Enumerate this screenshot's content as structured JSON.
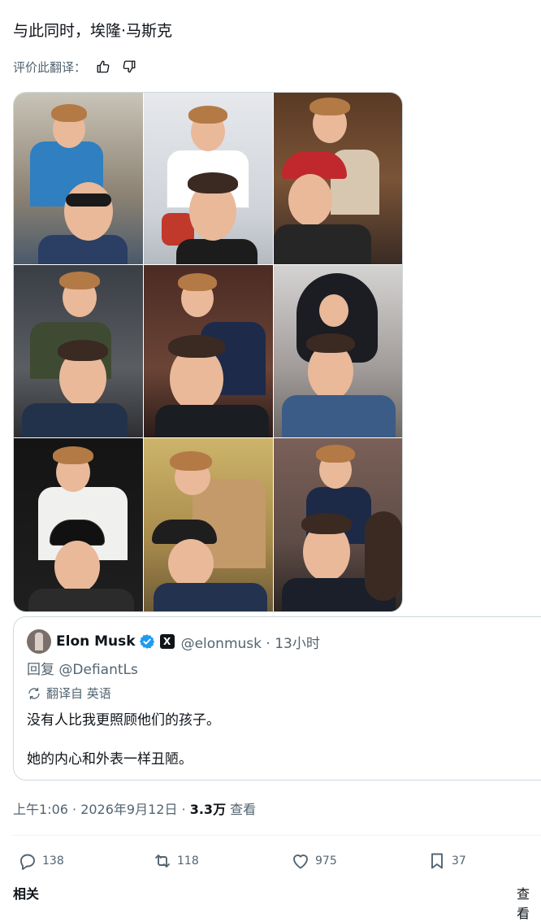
{
  "post": {
    "text": "与此同时，埃隆·马斯克",
    "rate_label": "评价此翻译：",
    "image_alt": "九宫格照片：埃隆·马斯克把孩子扛在肩上"
  },
  "quote": {
    "author_name": "Elon Musk",
    "handle_time": "@elonmusk · 13小时",
    "reply_prefix": "回复",
    "reply_to": "@DefiantLs",
    "translated_from": "翻译自 英语",
    "line1": "没有人比我更照顾他们的孩子。",
    "line2": "她的内心和外表一样丑陋。"
  },
  "meta": {
    "time_date": "上午1:06 · 2026年9月12日 · ",
    "views_count": "3.3万",
    "views_label": " 查看"
  },
  "actions": {
    "replies": "138",
    "reposts": "118",
    "likes": "975",
    "bookmarks": "37"
  },
  "footer": {
    "left": "相关",
    "right": "查看"
  },
  "colors": {
    "text": "#0f1419",
    "secondary": "#536471",
    "verified": "#1d9bf0",
    "border": "#cfd9de"
  }
}
